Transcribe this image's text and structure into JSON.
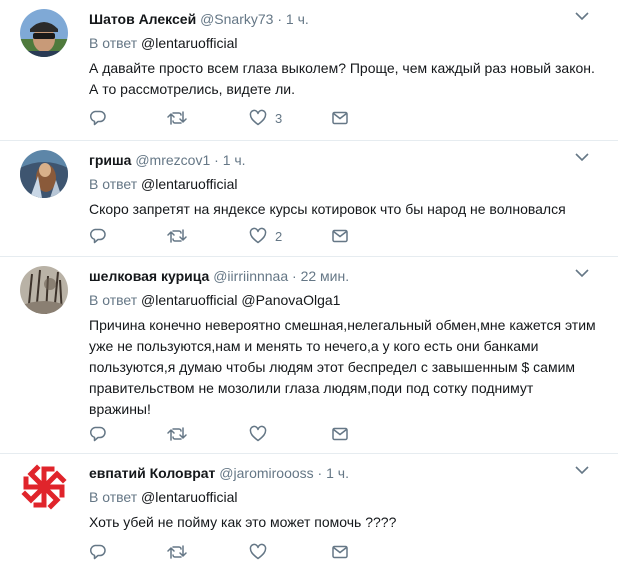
{
  "tweets": [
    {
      "name": "Шатов Алексей",
      "handle": "@Snarky73",
      "time": "1 ч.",
      "reply_prefix": "В ответ",
      "reply_to": "@lentaruofficial",
      "reply_to2": "",
      "text": "А давайте просто всем глаза выколем? Проще, чем каждый раз новый закон. А то рассмотрелись, видете ли.",
      "likes": "3"
    },
    {
      "name": "гриша",
      "handle": "@mrezcov1",
      "time": "1 ч.",
      "reply_prefix": "В ответ",
      "reply_to": "@lentaruofficial",
      "reply_to2": "",
      "text": "Скоро запретят на яндексе курсы котировок что бы народ не волновался",
      "likes": "2"
    },
    {
      "name": "шелковая курица",
      "handle": "@iirriinnnaa",
      "time": "22 мин.",
      "reply_prefix": "В ответ",
      "reply_to": "@lentaruofficial",
      "reply_to2": "@PanovaOlga1",
      "text": "Причина конечно невероятно смешная,нелегальный обмен,мне кажется этим уже не пользуются,нам и менять то нечего,а у кого есть они банками пользуются,я думаю чтобы людям этот беспредел с завышенным $ самим правительством не мозолили глаза людям,поди под сотку поднимут вражины!",
      "likes": ""
    },
    {
      "name": "евпатий Коловрат",
      "handle": "@jaromiroooss",
      "time": "1 ч.",
      "reply_prefix": "В ответ",
      "reply_to": "@lentaruofficial",
      "reply_to2": "",
      "text": "Хоть убей не пойму как это может помочь ????",
      "likes": ""
    }
  ],
  "separator": "·",
  "icons": {
    "reply": "reply-icon",
    "retweet": "retweet-icon",
    "like": "heart-icon",
    "dm": "envelope-icon",
    "menu": "chevron-down-icon"
  },
  "colors": {
    "muted": "#657786",
    "text": "#14171a",
    "border": "#e6ecf0",
    "logo_red": "#e0242b"
  }
}
